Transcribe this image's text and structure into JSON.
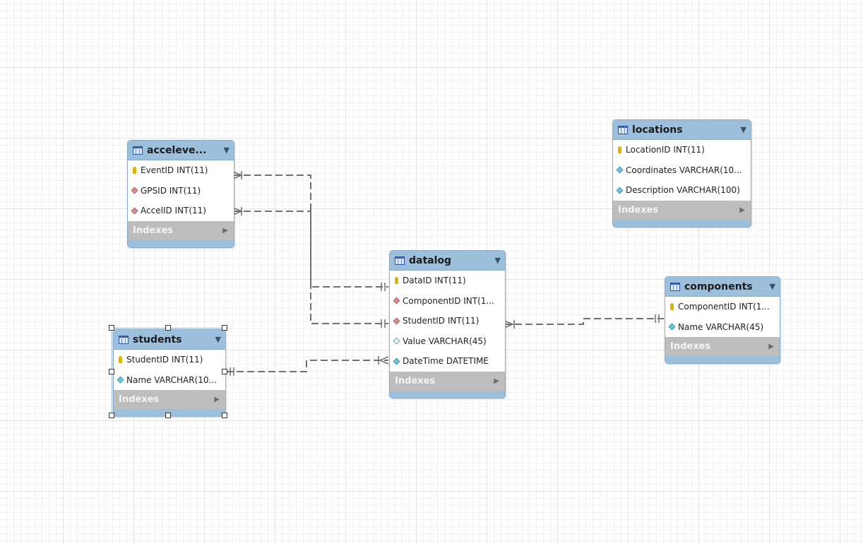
{
  "diagram": {
    "tables": [
      {
        "id": "acceleve",
        "name": "acceleve...",
        "columns": [
          {
            "label": "EventID INT(11)",
            "kind": "pk"
          },
          {
            "label": "GPSID INT(11)",
            "kind": "fk"
          },
          {
            "label": "AccelID INT(11)",
            "kind": "fk"
          }
        ],
        "indexes_label": "Indexes"
      },
      {
        "id": "locations",
        "name": "locations",
        "columns": [
          {
            "label": "LocationID INT(11)",
            "kind": "pk"
          },
          {
            "label": "Coordinates VARCHAR(10...",
            "kind": "attr"
          },
          {
            "label": "Description VARCHAR(100)",
            "kind": "attr"
          }
        ],
        "indexes_label": "Indexes"
      },
      {
        "id": "datalog",
        "name": "datalog",
        "columns": [
          {
            "label": "DataID INT(11)",
            "kind": "pk"
          },
          {
            "label": "ComponentID INT(1...",
            "kind": "fk"
          },
          {
            "label": "StudentID INT(11)",
            "kind": "fk"
          },
          {
            "label": "Value VARCHAR(45)",
            "kind": "attr-open"
          },
          {
            "label": "DateTime DATETIME",
            "kind": "attr"
          }
        ],
        "indexes_label": "Indexes"
      },
      {
        "id": "components",
        "name": "components",
        "columns": [
          {
            "label": "ComponentID INT(1...",
            "kind": "pk"
          },
          {
            "label": "Name VARCHAR(45)",
            "kind": "attr"
          }
        ],
        "indexes_label": "Indexes"
      },
      {
        "id": "students",
        "name": "students",
        "selected": true,
        "columns": [
          {
            "label": "StudentID INT(11)",
            "kind": "pk"
          },
          {
            "label": "Name VARCHAR(10...",
            "kind": "attr"
          }
        ],
        "indexes_label": "Indexes"
      }
    ],
    "relationships": [
      {
        "from": "acceleve.EventID",
        "to": "datalog.DataID",
        "from_end": "many",
        "to_end": "one"
      },
      {
        "from": "acceleve.AccelID",
        "to": "datalog.StudentID",
        "from_end": "many",
        "to_end": "one"
      },
      {
        "from": "students.StudentID",
        "to": "datalog.DateTime",
        "from_end": "one",
        "to_end": "many"
      },
      {
        "from": "datalog.StudentID",
        "to": "components.ComponentID",
        "from_end": "many",
        "to_end": "one"
      }
    ],
    "colors": {
      "header": "#9cbfdc",
      "indexes": "#bdbdbd",
      "connector": "#707070"
    },
    "icons": {
      "table": "table-icon",
      "menu": "dropdown-triangle-icon",
      "pk": "key-icon",
      "fk": "foreign-key-diamond-icon",
      "attr": "column-diamond-icon",
      "attr_open": "nullable-column-diamond-icon",
      "indexes_expand": "expand-arrow-icon"
    }
  }
}
